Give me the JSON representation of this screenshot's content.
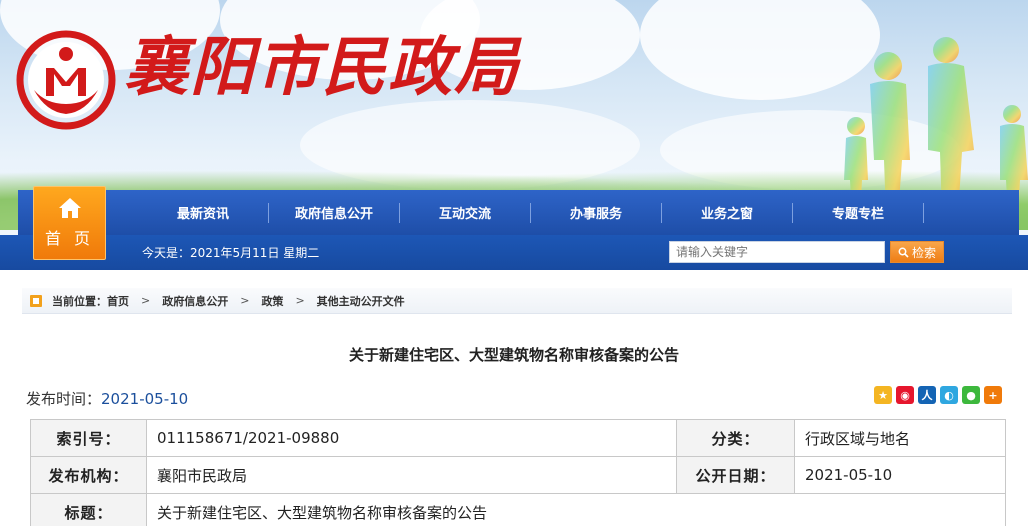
{
  "header": {
    "site_title": "襄阳市民政局",
    "colors": {
      "nav_blue": "#2e64c8",
      "home_orange": "#f07a0a",
      "title_red": "#d21a1a"
    }
  },
  "nav": {
    "home_label": "首 页",
    "items": [
      {
        "label": "最新资讯"
      },
      {
        "label": "政府信息公开"
      },
      {
        "label": "互动交流"
      },
      {
        "label": "办事服务"
      },
      {
        "label": "业务之窗"
      },
      {
        "label": "专题专栏"
      }
    ],
    "date_text": "今天是：2021年5月11日 星期二",
    "search": {
      "placeholder": "请输入关键字",
      "button_label": "检索"
    }
  },
  "breadcrumb": {
    "prefix": "当前位置：",
    "items": [
      "首页",
      "政府信息公开",
      "政策",
      "其他主动公开文件"
    ],
    "separator": ">"
  },
  "article": {
    "title": "关于新建住宅区、大型建筑物名称审核备案的公告",
    "pub_date_label": "发布时间：",
    "pub_date": "2021-05-10",
    "share_icons": [
      "qzone-icon",
      "weibo-icon",
      "renren-icon",
      "tqq-icon",
      "wechat-icon",
      "more-icon"
    ]
  },
  "info_table": {
    "rows": [
      {
        "k1": "索引号：",
        "v1": "011158671/2021-09880",
        "k2": "分类：",
        "v2": "行政区域与地名"
      },
      {
        "k1": "发布机构：",
        "v1": "襄阳市民政局",
        "k2": "公开日期：",
        "v2": "2021-05-10"
      },
      {
        "k1": "标题：",
        "v1": "关于新建住宅区、大型建筑物名称审核备案的公告"
      }
    ]
  }
}
